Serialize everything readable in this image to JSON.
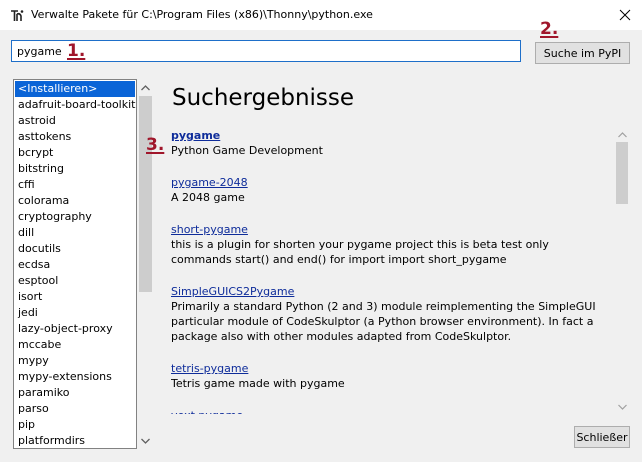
{
  "window": {
    "title": "Verwalte Pakete für C:\\Program Files (x86)\\Thonny\\python.exe",
    "app_icon": "thonny-icon",
    "close_icon": "close-icon"
  },
  "search": {
    "value": "pygame",
    "button_label": "Suche im PyPI"
  },
  "annotations": {
    "step1": "1.",
    "step2": "2.",
    "step3": "3."
  },
  "package_list": {
    "items": [
      "<Installieren>",
      "adafruit-board-toolkit",
      "astroid",
      "asttokens",
      "bcrypt",
      "bitstring",
      "cffi",
      "colorama",
      "cryptography",
      "dill",
      "docutils",
      "ecdsa",
      "esptool",
      "isort",
      "jedi",
      "lazy-object-proxy",
      "mccabe",
      "mypy",
      "mypy-extensions",
      "paramiko",
      "parso",
      "pip",
      "platformdirs"
    ],
    "selected_index": 0
  },
  "results": {
    "heading": "Suchergebnisse",
    "items": [
      {
        "name": "pygame",
        "description": "Python Game Development"
      },
      {
        "name": "pygame-2048",
        "description": "A 2048 game"
      },
      {
        "name": "short-pygame",
        "description": "this is a plugin for shorten your pygame project this is beta test only commands start() and end() for import import short_pygame"
      },
      {
        "name": "SimpleGUICS2Pygame",
        "description": "Primarily a standard Python (2 and 3) module reimplementing the SimpleGUI particular module of CodeSkulptor (a Python browser environment). In fact a package also with other modules adapted from CodeSkulptor."
      },
      {
        "name": "tetris-pygame",
        "description": "Tetris game made with pygame"
      },
      {
        "name": "vext.pygame",
        "description": ""
      }
    ]
  },
  "footer": {
    "close_label": "Schließer"
  },
  "colors": {
    "annotation": "#a0162b",
    "selection": "#0a64d7",
    "link": "#0e2c9a",
    "input_border": "#1e6fc9"
  }
}
